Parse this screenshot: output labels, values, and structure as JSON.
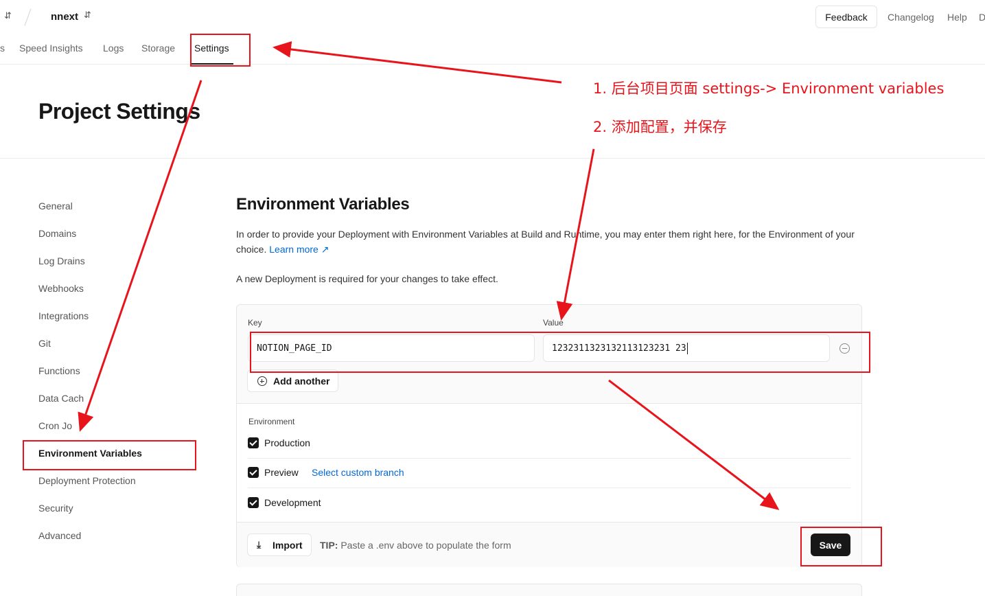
{
  "header": {
    "project_name": "nnext",
    "feedback_label": "Feedback",
    "links": [
      "Changelog",
      "Help",
      "D"
    ]
  },
  "tabs": {
    "items": [
      "s",
      "Speed Insights",
      "Logs",
      "Storage",
      "Settings"
    ],
    "active": "Settings"
  },
  "page": {
    "title": "Project Settings"
  },
  "sidebar": {
    "items": [
      {
        "label": "General"
      },
      {
        "label": "Domains"
      },
      {
        "label": "Log Drains"
      },
      {
        "label": "Webhooks"
      },
      {
        "label": "Integrations"
      },
      {
        "label": "Git"
      },
      {
        "label": "Functions"
      },
      {
        "label": "Data Cach"
      },
      {
        "label": "Cron Jo"
      },
      {
        "label": "Environment Variables",
        "active": true
      },
      {
        "label": "Deployment Protection"
      },
      {
        "label": "Security"
      },
      {
        "label": "Advanced"
      }
    ]
  },
  "main": {
    "section_title": "Environment Variables",
    "description": "In order to provide your Deployment with Environment Variables at Build and Runtime, you may enter them right here, for the Environment of your choice.",
    "learn_more": "Learn more",
    "note": "A new Deployment is required for your changes to take effect.",
    "form": {
      "key_label": "Key",
      "value_label": "Value",
      "key_value": "NOTION_PAGE_ID",
      "value_value": "1232311323132113123231 23",
      "add_another": "Add another",
      "environment_label": "Environment",
      "environments": [
        {
          "name": "Production",
          "checked": true
        },
        {
          "name": "Preview",
          "checked": true,
          "link": "Select custom branch"
        },
        {
          "name": "Development",
          "checked": true
        }
      ],
      "import_label": "Import",
      "tip_prefix": "TIP:",
      "tip_text": "Paste a .env above to populate the form",
      "save_label": "Save"
    }
  },
  "annotations": {
    "step1": "1. 后台项目页面 settings-> Environment variables",
    "step2": "2. 添加配置，并保存",
    "color": "#e8141c"
  },
  "colors": {
    "accent_link": "#0068d6",
    "primary_button": "#171717"
  }
}
